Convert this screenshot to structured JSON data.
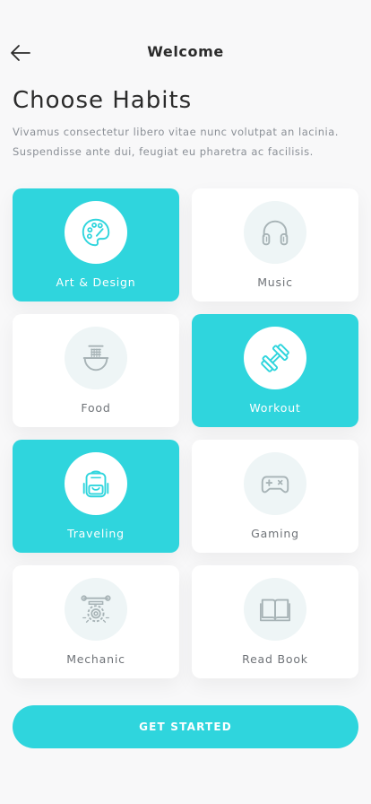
{
  "header": {
    "title": "Welcome"
  },
  "title": "Choose Habits",
  "description": "Vivamus consectetur libero vitae nunc volutpat an lacinia. Suspendisse ante dui, feugiat eu pharetra ac facilisis.",
  "habits": [
    {
      "label": "Art & Design",
      "icon": "palette-icon",
      "selected": true
    },
    {
      "label": "Music",
      "icon": "headphones-icon",
      "selected": false
    },
    {
      "label": "Food",
      "icon": "noodle-bowl-icon",
      "selected": false
    },
    {
      "label": "Workout",
      "icon": "dumbbell-icon",
      "selected": true
    },
    {
      "label": "Traveling",
      "icon": "backpack-icon",
      "selected": true
    },
    {
      "label": "Gaming",
      "icon": "gamepad-icon",
      "selected": false
    },
    {
      "label": "Mechanic",
      "icon": "gear-wrench-icon",
      "selected": false
    },
    {
      "label": "Read Book",
      "icon": "book-icon",
      "selected": false
    }
  ],
  "cta": {
    "label": "GET STARTED"
  },
  "colors": {
    "accent": "#2fd5dd",
    "icon_inactive": "#a7b3b6",
    "icon_active": "#2fd5dd"
  }
}
